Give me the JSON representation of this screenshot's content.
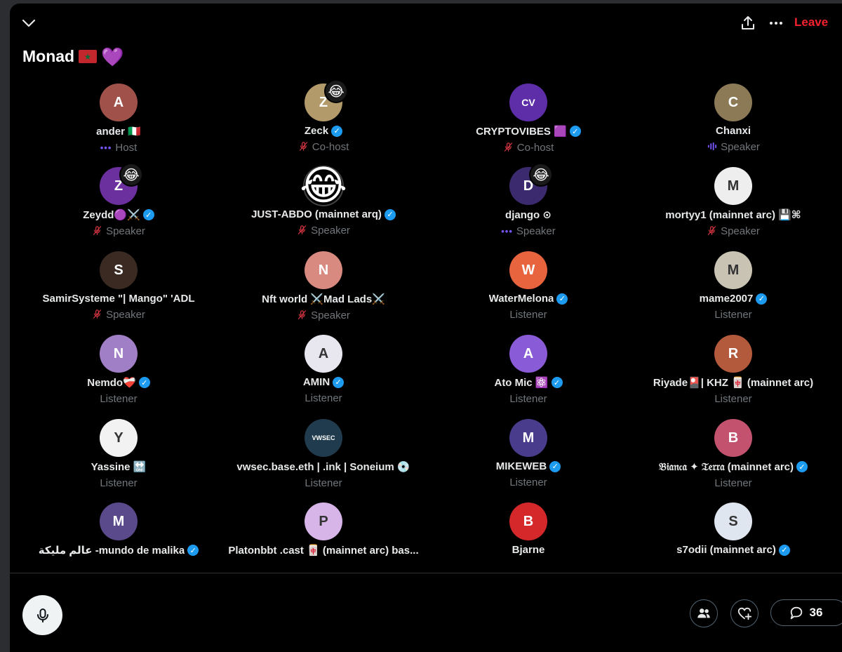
{
  "space": {
    "title": "Monad",
    "title_flag": "★",
    "title_heart": "💜",
    "leave_label": "Leave"
  },
  "participants": [
    {
      "name": "ander 🇮🇹",
      "verified": false,
      "role": "Host",
      "role_icon": "host",
      "avatar_color": "#a0524a",
      "avatar_initial": "A"
    },
    {
      "name": "Zeck",
      "verified": true,
      "role": "Co-host",
      "role_icon": "mic-off",
      "avatar_color": "#b39a6b",
      "avatar_initial": "Z",
      "reaction": "😂"
    },
    {
      "name": "CRYPTOVIBES 🟪",
      "verified": true,
      "role": "Co-host",
      "role_icon": "mic-off",
      "avatar_color": "#5d2ea8",
      "avatar_initial": "CV"
    },
    {
      "name": "Chanxi",
      "verified": false,
      "role": "Speaker",
      "role_icon": "speaking",
      "avatar_color": "#8c7a56",
      "avatar_initial": "C"
    },
    {
      "name": "Zeydd🟣⚔️",
      "verified": true,
      "role": "Speaker",
      "role_icon": "mic-off",
      "avatar_color": "#6b2f9e",
      "avatar_initial": "Z",
      "reaction": "😂"
    },
    {
      "name": "JUST-ABDO (mainnet arq)",
      "verified": true,
      "role": "Speaker",
      "role_icon": "mic-off",
      "avatar_color": "#000000",
      "avatar_emoji": "😂"
    },
    {
      "name": "django ⊙",
      "verified": false,
      "role": "Speaker",
      "role_icon": "host",
      "avatar_color": "#3b2a6e",
      "avatar_initial": "D",
      "reaction": "😂"
    },
    {
      "name": "mortyy1 (mainnet arc) 💾⌘",
      "verified": false,
      "role": "Speaker",
      "role_icon": "mic-off",
      "avatar_color": "#eeeeee",
      "avatar_initial": "M"
    },
    {
      "name": "SamirSysteme \"| Mango\" 'ADL",
      "verified": false,
      "role": "Speaker",
      "role_icon": "mic-off",
      "avatar_color": "#3a2a22",
      "avatar_initial": "S"
    },
    {
      "name": "Nft world ⚔️Mad Lads⚔️",
      "verified": false,
      "role": "Speaker",
      "role_icon": "mic-off",
      "avatar_color": "#d98a80",
      "avatar_initial": "N"
    },
    {
      "name": "WaterMelona",
      "verified": true,
      "role": "Listener",
      "role_icon": "",
      "avatar_color": "#e8643e",
      "avatar_initial": "W"
    },
    {
      "name": "mame2007",
      "verified": true,
      "role": "Listener",
      "role_icon": "",
      "avatar_color": "#c9c3b3",
      "avatar_initial": "M"
    },
    {
      "name": "Nemdo❤️‍🩹",
      "verified": true,
      "role": "Listener",
      "role_icon": "",
      "avatar_color": "#a17fc7",
      "avatar_initial": "N"
    },
    {
      "name": "AMIN",
      "verified": true,
      "role": "Listener",
      "role_icon": "",
      "avatar_color": "#e8e6ef",
      "avatar_initial": "A"
    },
    {
      "name": "Ato Mic ⚛️",
      "verified": true,
      "role": "Listener",
      "role_icon": "",
      "avatar_color": "#8a5bd6",
      "avatar_initial": "A"
    },
    {
      "name": "Riyade🎴| KHZ 🀄 (mainnet arc)",
      "verified": false,
      "role": "Listener",
      "role_icon": "",
      "avatar_color": "#b35a3c",
      "avatar_initial": "R"
    },
    {
      "name": "Yassine 🔛",
      "verified": false,
      "role": "Listener",
      "role_icon": "",
      "avatar_color": "#f2f2f2",
      "avatar_initial": "Y"
    },
    {
      "name": "vwsec.base.eth | .ink | Soneium 💿",
      "verified": false,
      "role": "Listener",
      "role_icon": "",
      "avatar_color": "#1f3b4d",
      "avatar_initial": "VWSEC"
    },
    {
      "name": "MIKEWEB",
      "verified": true,
      "role": "Listener",
      "role_icon": "",
      "avatar_color": "#4a3c8c",
      "avatar_initial": "M"
    },
    {
      "name": "𝔅𝔦𝔞𝔫𝔠𝔞 ✦ 𝔗𝔢𝔯𝔯𝔞 (mainnet arc)",
      "verified": true,
      "role": "Listener",
      "role_icon": "",
      "avatar_color": "#c2526e",
      "avatar_initial": "B"
    },
    {
      "name": "عالم مليكة -mundo de malika",
      "verified": true,
      "role": "",
      "role_icon": "",
      "avatar_color": "#5a4a8c",
      "avatar_initial": "M"
    },
    {
      "name": "Platonbbt .cast 🀄 (mainnet arc) bas...",
      "verified": false,
      "role": "",
      "role_icon": "",
      "avatar_color": "#d7b5e8",
      "avatar_initial": "P"
    },
    {
      "name": "Bjarne",
      "verified": false,
      "role": "",
      "role_icon": "",
      "avatar_color": "#d4282b",
      "avatar_initial": "B"
    },
    {
      "name": "s7odii (mainnet arc)",
      "verified": true,
      "role": "",
      "role_icon": "",
      "avatar_color": "#e0e6ef",
      "avatar_initial": "S"
    }
  ],
  "footer": {
    "comments_count": "36"
  }
}
